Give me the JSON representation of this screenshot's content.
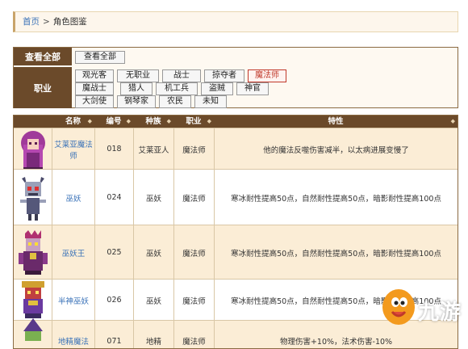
{
  "breadcrumb": {
    "home": "首页",
    "separator": ">",
    "current": "角色图鉴"
  },
  "filter": {
    "all_label": "查看全部",
    "all_button": "查看全部",
    "job_label": "职业",
    "jobs": [
      "观光客",
      "无职业",
      "战士",
      "掠夺者",
      "魔法师",
      "魔战士",
      "猎人",
      "机工兵",
      "盗贼",
      "神官",
      "大剑使",
      "钢琴家",
      "农民",
      "未知"
    ],
    "active_job": "魔法师"
  },
  "table": {
    "headers": [
      "名称",
      "编号",
      "种族",
      "职业",
      "特性"
    ],
    "rows": [
      {
        "name": "艾莱亚魔法师",
        "id": "018",
        "race": "艾莱亚人",
        "job": "魔法师",
        "trait": "他的魔法反噬伤害减半，以太病进展变慢了"
      },
      {
        "name": "巫妖",
        "id": "024",
        "race": "巫妖",
        "job": "魔法师",
        "trait": "寒冰耐性提高50点，自然耐性提高50点，暗影耐性提高100点"
      },
      {
        "name": "巫妖王",
        "id": "025",
        "race": "巫妖",
        "job": "魔法师",
        "trait": "寒冰耐性提高50点，自然耐性提高50点，暗影耐性提高100点"
      },
      {
        "name": "半神巫妖",
        "id": "026",
        "race": "巫妖",
        "job": "魔法师",
        "trait": "寒冰耐性提高50点，自然耐性提高50点，暗影耐性提高100点"
      },
      {
        "name": "地精魔法",
        "id": "071",
        "race": "地精",
        "job": "魔法师",
        "trait": "物理伤害+10%，法术伤害-10%"
      }
    ]
  },
  "watermark": {
    "text": "九游"
  },
  "colors": {
    "header_brown": "#6b4a2a",
    "row_tint": "#fbedd6",
    "link_blue": "#3a72b8",
    "active_red": "#c0392b"
  }
}
